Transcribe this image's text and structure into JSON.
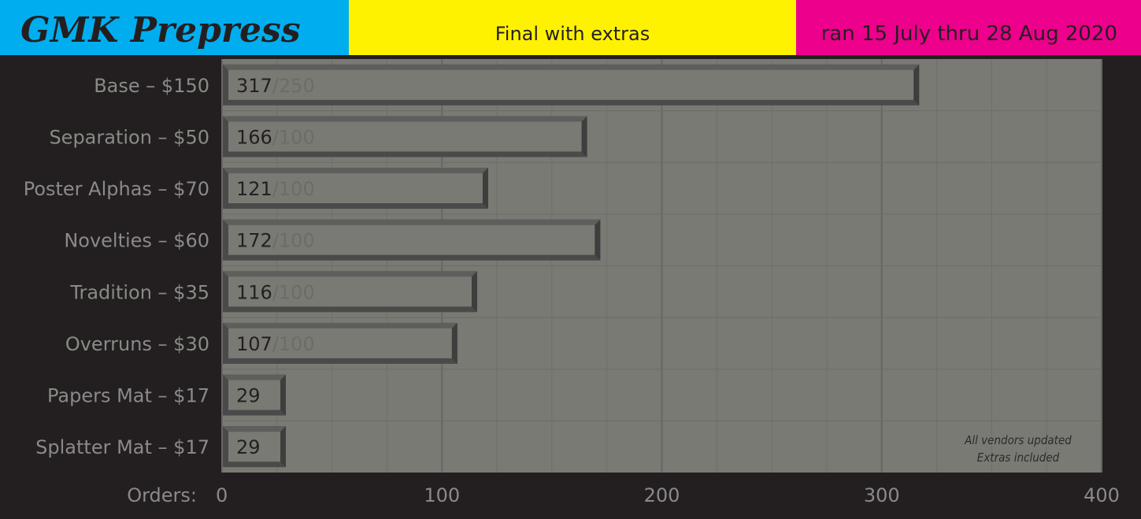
{
  "header": {
    "title": "GMK Prepress",
    "subtitle": "Final with extras",
    "date_range": "ran 15 July thru 28 Aug 2020"
  },
  "colors": {
    "cyan": "#00aeef",
    "yellow": "#fff200",
    "magenta": "#ec008c",
    "background": "#231f20",
    "plot_area": "#7a7a74",
    "bar_fill": "#7a7a74",
    "bar_border": "#525252",
    "label_text": "#8a8a86",
    "value_text": "#231f20",
    "target_text": "#6c6c68"
  },
  "chart_data": {
    "type": "bar",
    "orientation": "horizontal",
    "categories": [
      "Base – $150",
      "Separation – $50",
      "Poster Alphas – $70",
      "Novelties – $60",
      "Tradition – $35",
      "Overruns – $30",
      "Papers Mat – $17",
      "Splatter Mat – $17"
    ],
    "values": [
      317,
      166,
      121,
      172,
      116,
      107,
      29,
      29
    ],
    "value_labels": [
      "317",
      "166",
      "121",
      "172",
      "116",
      "107",
      "29",
      "29"
    ],
    "target_labels": [
      "/250",
      "/100",
      "/100",
      "/100",
      "/100",
      "/100",
      "",
      ""
    ],
    "xlabel": "Orders:",
    "xlim": [
      0,
      400
    ],
    "xticks": [
      0,
      100,
      200,
      300,
      400
    ],
    "xtick_labels": [
      "0",
      "100",
      "200",
      "300",
      "400"
    ],
    "minor_gridline_step": 25,
    "grid": true,
    "annotation": [
      "All vendors updated",
      "Extras included"
    ]
  }
}
